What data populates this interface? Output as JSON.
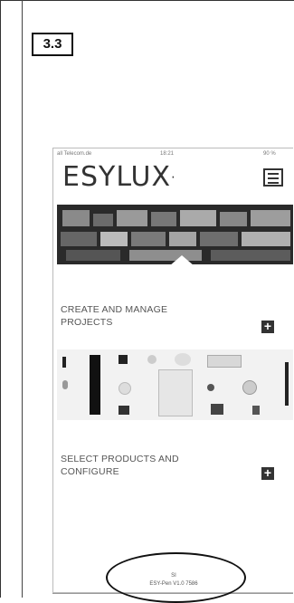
{
  "step": {
    "label": "3.3"
  },
  "phone": {
    "status": {
      "carrier": "all Telecom.de",
      "time": "18:21",
      "battery": "90 %"
    },
    "logo": {
      "text": "ESYLUX",
      "mark": "·"
    },
    "sections": [
      {
        "label_line1": "CREATE AND MANAGE",
        "label_line2": "PROJECTS",
        "action": "+"
      },
      {
        "label_line1": "SELECT PRODUCTS AND",
        "label_line2": "CONFIGURE",
        "action": "+"
      }
    ],
    "footer": {
      "icon_text": "SI",
      "version": "ESY-Pen V1.0 7586"
    }
  },
  "colors": {
    "frame": "#111111",
    "accent": "#333333"
  }
}
